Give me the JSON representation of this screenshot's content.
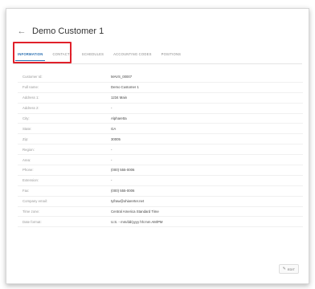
{
  "header": {
    "back_icon": "arrow-left-icon",
    "title": "Demo Customer 1"
  },
  "tabs": [
    {
      "label": "INFORMATION",
      "active": true
    },
    {
      "label": "CONTACTS",
      "active": false
    },
    {
      "label": "SCHEDULES",
      "active": false
    },
    {
      "label": "ACCOUNTING CODES",
      "active": false
    },
    {
      "label": "POSITIONS",
      "active": false
    }
  ],
  "fields": [
    {
      "label": "Customer Id:",
      "value": "MAVS_00007"
    },
    {
      "label": "Full name:",
      "value": "Demo Customer 1"
    },
    {
      "label": "Address 1:",
      "value": "1234 Main"
    },
    {
      "label": "Address 2:",
      "value": "-"
    },
    {
      "label": "City:",
      "value": "Alpharetta"
    },
    {
      "label": "State:",
      "value": "GA"
    },
    {
      "label": "Zip:",
      "value": "30005"
    },
    {
      "label": "Region:",
      "value": "-"
    },
    {
      "label": "Area:",
      "value": "-"
    },
    {
      "label": "Phone:",
      "value": "(000) 555-0006"
    },
    {
      "label": "Extension:",
      "value": "-"
    },
    {
      "label": "Fax:",
      "value": "(000) 555-0006"
    },
    {
      "label": "Company email:",
      "value": "tyfraw@ohiarerter.net"
    },
    {
      "label": "Time zone:",
      "value": "Central America Standard Time"
    },
    {
      "label": "Date format:",
      "value": "U.S. - mm/dd/yyyy hh:mm AM/PM"
    }
  ],
  "edit_button": {
    "label": "EDIT",
    "icon": "pencil-icon"
  },
  "highlight_color": "#e0202a",
  "accent_color": "#2a6fb0"
}
